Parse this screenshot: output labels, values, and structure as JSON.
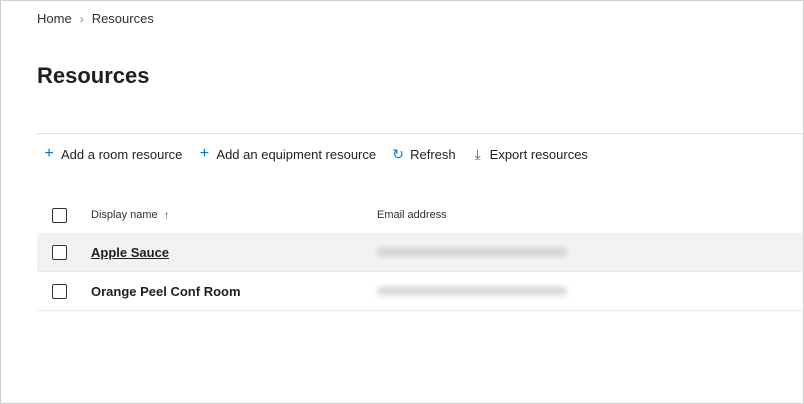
{
  "breadcrumb": {
    "home": "Home",
    "current": "Resources"
  },
  "page": {
    "title": "Resources"
  },
  "commandbar": {
    "add_room": "Add a room resource",
    "add_equipment": "Add an equipment resource",
    "refresh": "Refresh",
    "export": "Export resources"
  },
  "table": {
    "columns": {
      "display_name": "Display name",
      "email": "Email address"
    },
    "rows": [
      {
        "name": "Apple Sauce"
      },
      {
        "name": "Orange Peel Conf Room"
      }
    ]
  },
  "icons": {
    "add": "plus-icon",
    "refresh": "refresh-icon",
    "export": "download-icon",
    "sort": "sort-ascending-icon",
    "separator": "chevron-right-icon"
  },
  "colors": {
    "accent": "#0078d4",
    "selected_row": "#f3f2f1"
  }
}
